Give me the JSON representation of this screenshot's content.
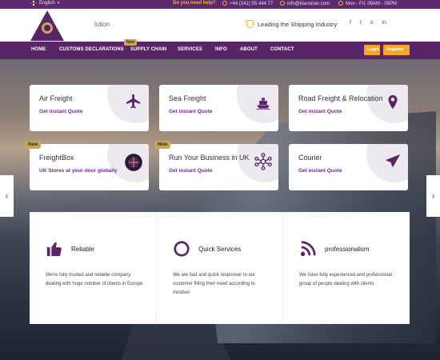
{
  "topbar": {
    "language": "English",
    "help_label": "Do you need help?",
    "phone": "+44 (141) 55 444 77",
    "email": "info@klanorian.com",
    "hours": "Mon - Fri: 09AM - 05PM"
  },
  "header": {
    "brand_fragment": "lution",
    "tagline": "Leading the Shipping Industry",
    "logo_text": "KLANORIAN'S",
    "socials": [
      "f",
      "t",
      "s",
      "in"
    ]
  },
  "nav": {
    "items": [
      "HOME",
      "CUSTOMS DECLARATIONS",
      "SUPPLY CHAIN",
      "SERVICES",
      "INFO",
      "ABOUT",
      "CONTACT"
    ],
    "new_badge": "New",
    "login": "Login",
    "register": "Register"
  },
  "services": [
    {
      "title": "Air Freight",
      "subtitle": "Get instant Quote",
      "icon": "airplane-icon"
    },
    {
      "title": "Sea Freight",
      "subtitle": "Get instant Quote",
      "icon": "ship-icon"
    },
    {
      "title": "Road Freight & Relocation",
      "subtitle": "Get instant Quote",
      "icon": "map-pin-icon"
    },
    {
      "title": "FreightBox",
      "subtitle": "UK Stores at your door globally",
      "icon": "globe-box-icon",
      "badge": "New"
    },
    {
      "title": "Run Your Business in UK",
      "subtitle": "Get instant Quote",
      "icon": "network-icon",
      "badge": "New"
    },
    {
      "title": "Courier",
      "subtitle": "Get instant Quote",
      "icon": "paper-plane-icon"
    }
  ],
  "features": [
    {
      "title": "Reliable",
      "description": "We're fully trusted and reliable company dealing with huge number of clients in Europe",
      "icon": "thumbs-up-icon"
    },
    {
      "title": "Quick Services",
      "description": "We are fast and quick responser to our customer filling their need according to mindset",
      "icon": "circle-icon"
    },
    {
      "title": "professionalism",
      "description": "We have fully experienced and professional group of people dealing with clients",
      "icon": "rss-icon"
    }
  ],
  "colors": {
    "primary": "#5a2568",
    "accent": "#f5a623",
    "badge": "#c7a65a",
    "link": "#6b2f86"
  }
}
